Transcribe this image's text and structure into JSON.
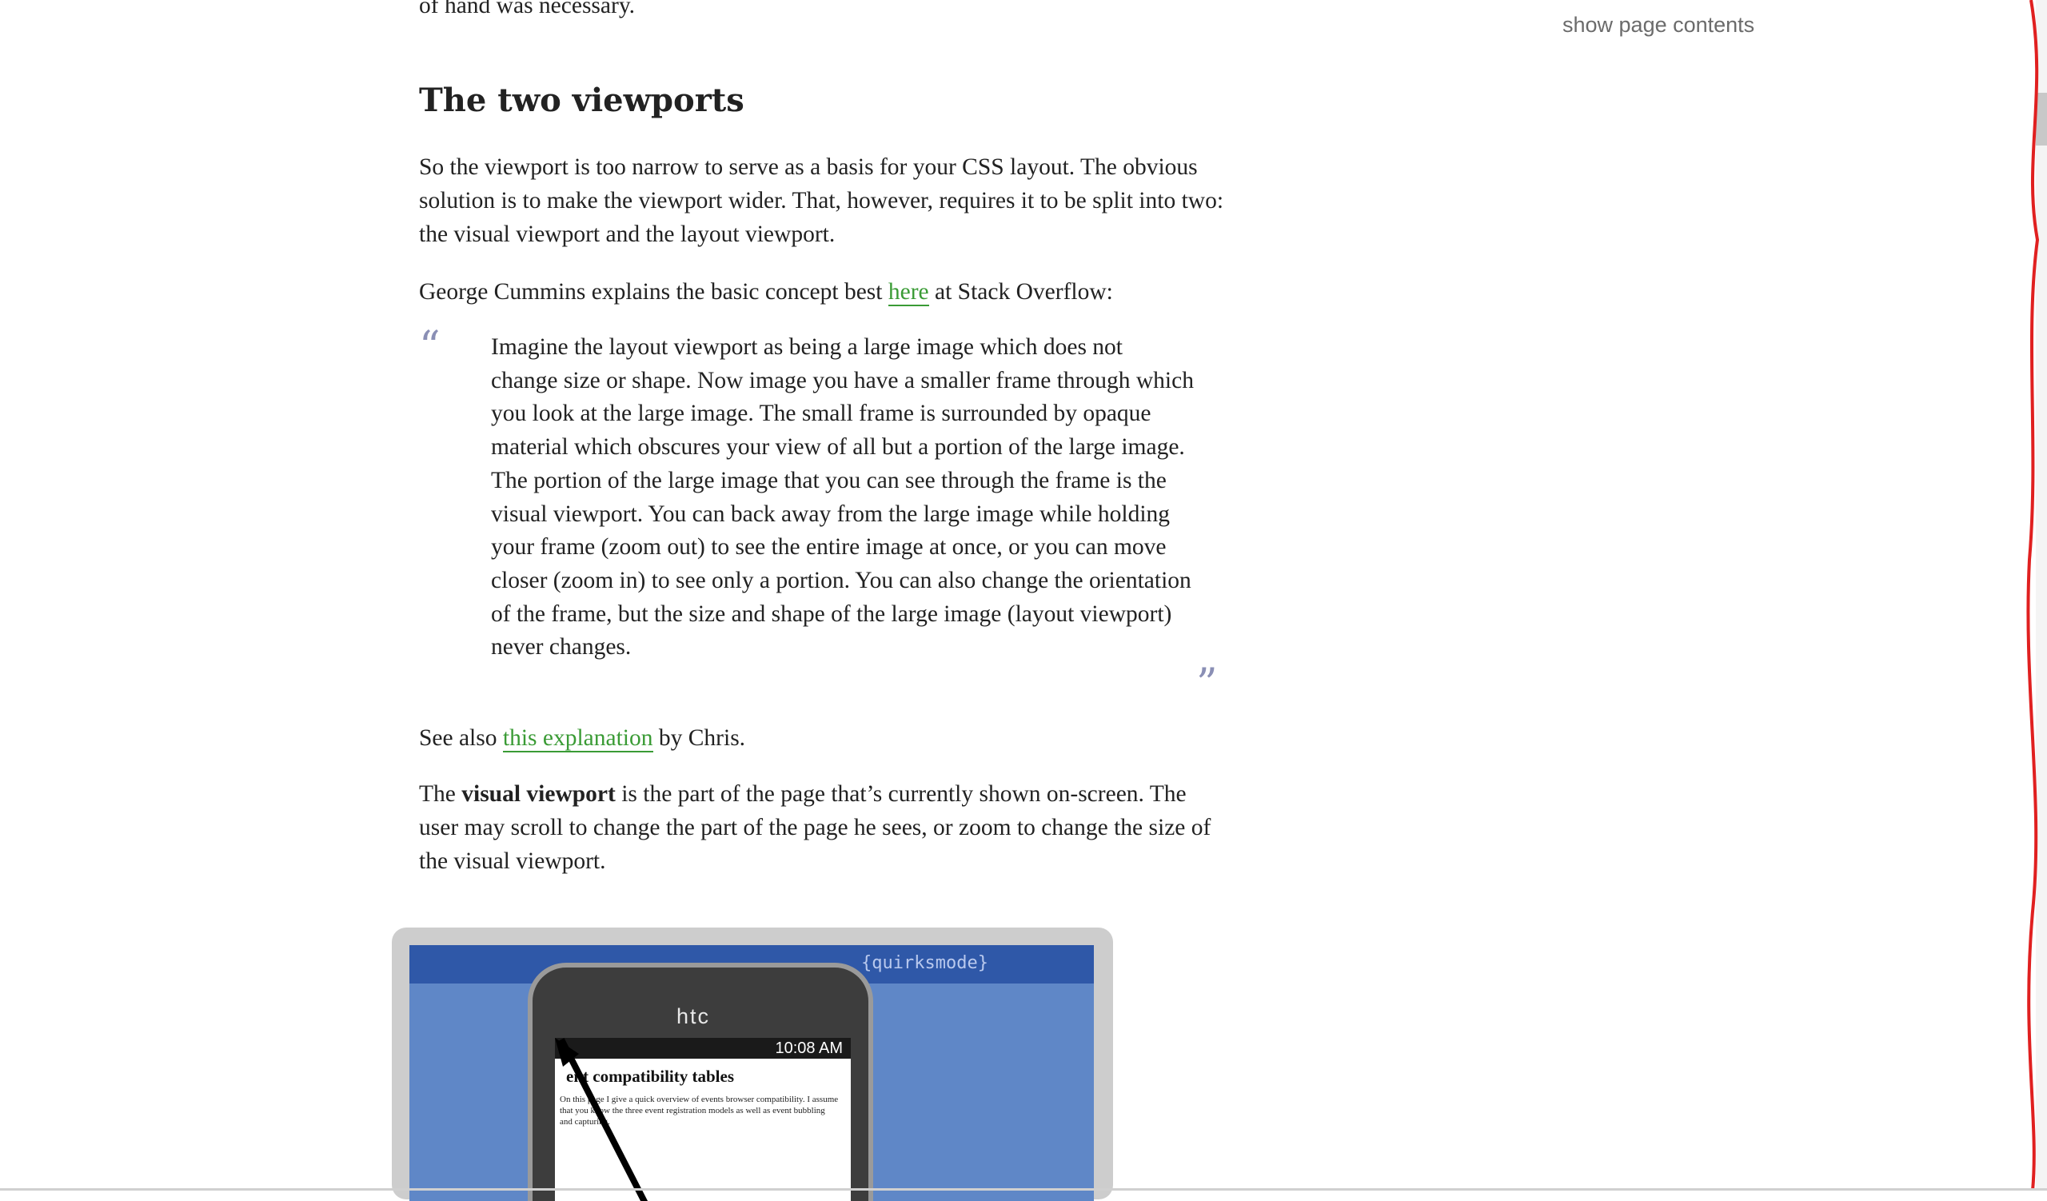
{
  "page": {
    "top_fragment": "of hand was necessary.",
    "show_contents": "show page contents",
    "heading": "The two viewports",
    "p1": "So the viewport is too narrow to serve as a basis for your CSS layout. The obvi­ous solution is to make the viewport wider. That, however, requires it to be split into two: the visual viewport and the layout viewport.",
    "p2_before": "George Cummins explains the basic concept best ",
    "p2_link": "here",
    "p2_after": " at Stack Overflow:",
    "quote_open": "“",
    "quote_close": "”",
    "blockquote": "Imagine the layout viewport as being a large image which does not change size or shape. Now image you have a smaller frame through which you look at the large image. The small frame is surrounded by opaque material which obscures your view of all but a portion of the large image. The portion of the large image that you can see through the frame is the visual viewport. You can back away from the large image while holding your frame (zoom out) to see the entire image at once, or you can move closer (zoom in) to see only a portion. You can also change the orientation of the frame, but the size and shape of the large im­age (layout viewport) never changes.",
    "p3_before": "See also ",
    "p3_link": "this explanation",
    "p3_after": " by Chris.",
    "p4_before": "The ",
    "p4_bold": "visual viewport",
    "p4_after": " is the part of the page that’s currently shown on-screen. The user may scroll to change the part of the page he sees, or zoom to change the size of the visual viewport."
  },
  "figure": {
    "site_title": "{quirksmode}",
    "phone_brand": "htc",
    "status_time": "10:08 AM",
    "phone_heading": "ent compatibility tables",
    "phone_text": "On this page I give a quick overview of events browser compatibility. I assume that you know the three event registration models as well as event bubbling and capturing."
  },
  "colors": {
    "link": "#3a9b35",
    "quote_mark": "#8a8fb5",
    "muted": "#6b6b6b"
  }
}
